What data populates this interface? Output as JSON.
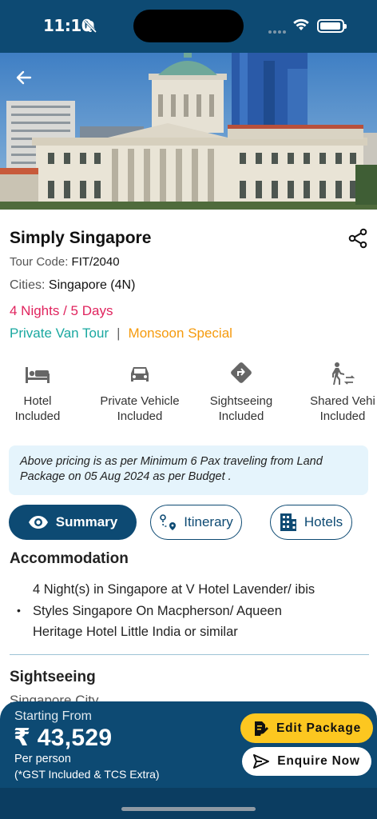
{
  "status": {
    "time": "11:10"
  },
  "package": {
    "title": "Simply Singapore",
    "tour_code_label": "Tour Code:",
    "tour_code": "FIT/2040",
    "cities_label": "Cities:",
    "cities": "Singapore (4N)",
    "duration": "4 Nights / 5 Days",
    "tag_primary": "Private Van Tour",
    "tag_separator": "|",
    "tag_secondary": "Monsoon Special"
  },
  "inclusions": [
    {
      "icon": "bed-icon",
      "line1": "Hotel",
      "line2": "Included"
    },
    {
      "icon": "car-icon",
      "line1": "Private Vehicle",
      "line2": "Included"
    },
    {
      "icon": "directions-icon",
      "line1": "Sightseeing",
      "line2": "Included"
    },
    {
      "icon": "transfer-icon",
      "line1": "Shared Vehi",
      "line2": "Included"
    }
  ],
  "note": "Above pricing is as per Minimum 6 Pax traveling from Land Package  on 05 Aug 2024 as per Budget .",
  "tabs": [
    {
      "label": "Summary",
      "icon": "eye-icon",
      "active": true
    },
    {
      "label": "Itinerary",
      "icon": "route-icon",
      "active": false
    },
    {
      "label": "Hotels",
      "icon": "building-icon",
      "active": false
    }
  ],
  "accommodation": {
    "title": "Accommodation",
    "bullet": "•",
    "lines": [
      "4 Night(s) in Singapore at  V Hotel Lavender/ ibis",
      "Styles Singapore On Macpherson/ Aqueen",
      "Heritage Hotel Little India or similar"
    ]
  },
  "sightseeing": {
    "title": "Sightseeing",
    "peek": "Singapore City"
  },
  "footer": {
    "starting_from": "Starting From",
    "price": "₹ 43,529",
    "per_person": "Per person",
    "tax_note": "(*GST Included & TCS Extra)",
    "edit_label": "Edit Package",
    "enquire_label": "Enquire Now"
  },
  "colors": {
    "brand_navy": "#0d4a73",
    "accent_yellow": "#fcc720",
    "duration_pink": "#e0245e",
    "tag_teal": "#1aa8a0",
    "tag_orange": "#f59a0c",
    "note_bg": "#e5f4fc"
  }
}
